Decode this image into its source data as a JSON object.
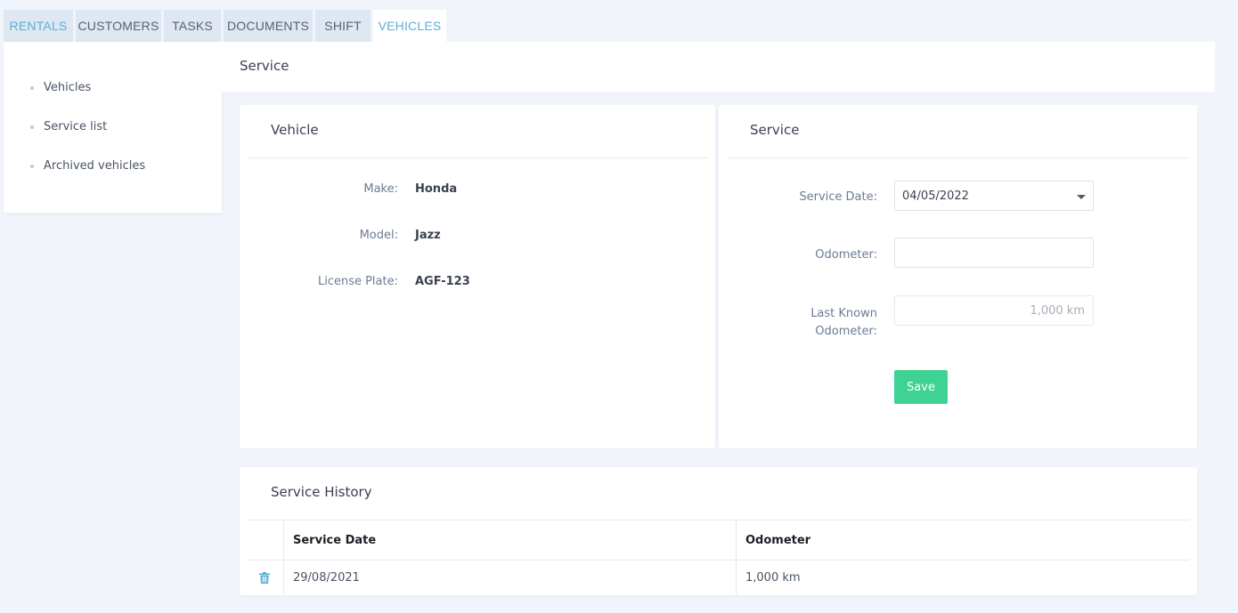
{
  "tabs": [
    {
      "label": "RENTALS"
    },
    {
      "label": "CUSTOMERS"
    },
    {
      "label": "TASKS"
    },
    {
      "label": "DOCUMENTS"
    },
    {
      "label": "SHIFT"
    },
    {
      "label": "VEHICLES"
    }
  ],
  "sidebar": {
    "items": [
      {
        "label": "Vehicles"
      },
      {
        "label": "Service list"
      },
      {
        "label": "Archived vehicles"
      }
    ]
  },
  "header": {
    "title": "Service"
  },
  "vehicle_card": {
    "title": "Vehicle",
    "make_label": "Make:",
    "make_value": "Honda",
    "model_label": "Model:",
    "model_value": "Jazz",
    "plate_label": "License Plate:",
    "plate_value": "AGF-123"
  },
  "service_card": {
    "title": "Service",
    "date_label": "Service Date:",
    "date_value": "04/05/2022",
    "odometer_label": "Odometer:",
    "odometer_value": "",
    "last_label_line1": "Last Known",
    "last_label_line2": "Odometer:",
    "last_placeholder": "1,000 km",
    "save_label": "Save"
  },
  "history": {
    "title": "Service History",
    "col_date": "Service Date",
    "col_odometer": "Odometer",
    "rows": [
      {
        "date": "29/08/2021",
        "odometer": "1,000 km"
      }
    ]
  },
  "colors": {
    "accent": "#5ab0d8",
    "save": "#3ed394",
    "background": "#f1f5fb"
  }
}
